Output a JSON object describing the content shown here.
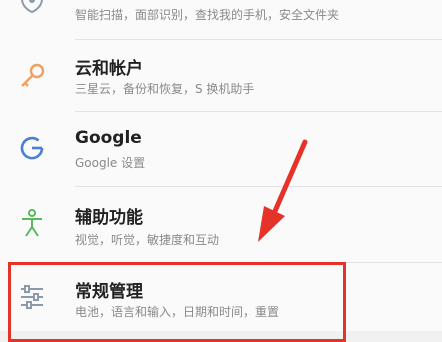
{
  "items": [
    {
      "id": "security",
      "title": "",
      "subtitle": "智能扫描，面部识别，查找我的手机，安全文件夹"
    },
    {
      "id": "cloud",
      "title": "云和帐户",
      "subtitle": "三星云，备份和恢复，S 换机助手"
    },
    {
      "id": "google",
      "title": "Google",
      "subtitle": "Google 设置"
    },
    {
      "id": "accessibility",
      "title": "辅助功能",
      "subtitle": "视觉，听觉，敏捷度和互动"
    },
    {
      "id": "general",
      "title": "常规管理",
      "subtitle": "电池，语言和输入，日期和时间，重置"
    }
  ],
  "colors": {
    "key_icon": "#f0a060",
    "google_icon": "#4a7fd4",
    "accessibility_icon": "#5cb85c",
    "general_icon": "#8a9aaa",
    "highlight": "#e6332a"
  }
}
